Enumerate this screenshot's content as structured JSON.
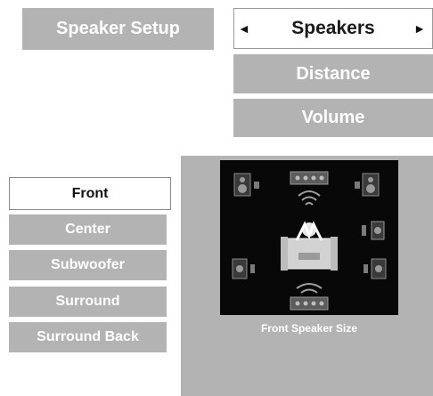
{
  "header": {
    "title": "Speaker Setup"
  },
  "tabs": [
    {
      "label": "Speakers",
      "prev_arrow": "◄",
      "next_arrow": "►"
    },
    {
      "label": "Distance"
    },
    {
      "label": "Volume"
    }
  ],
  "speaker_list": [
    {
      "label": "Front"
    },
    {
      "label": "Center"
    },
    {
      "label": "Subwoofer"
    },
    {
      "label": "Surround"
    },
    {
      "label": "Surround Back"
    }
  ],
  "preview": {
    "caption": "Front Speaker Size"
  }
}
